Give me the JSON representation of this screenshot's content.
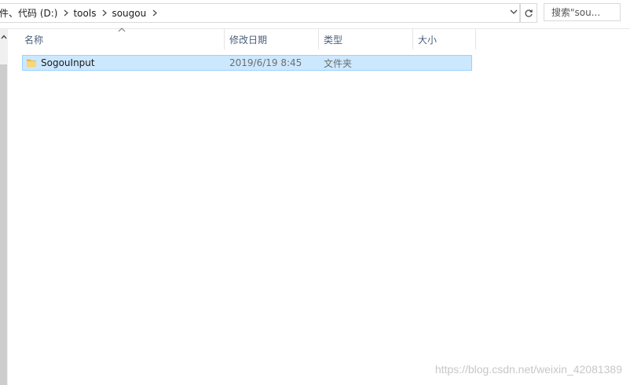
{
  "address_bar": {
    "crumbs": [
      "件、代码 (D:)",
      "tools",
      "sougou"
    ]
  },
  "search": {
    "placeholder": "搜索\"sou..."
  },
  "columns": {
    "name": "名称",
    "modified": "修改日期",
    "type": "类型",
    "size": "大小"
  },
  "files": [
    {
      "name": "SogouInput",
      "modified": "2019/6/19 8:45",
      "type": "文件夹",
      "size": ""
    }
  ],
  "watermark": "https://blog.csdn.net/weixin_42081389",
  "colors": {
    "selection_bg": "#cce8ff",
    "selection_border": "#99d1ff",
    "header_text": "#4c607a",
    "folder_yellow": "#f8d775"
  },
  "icons": {
    "breadcrumb_separator": "chevron-right-icon",
    "address_dropdown": "chevron-down-icon",
    "refresh": "refresh-icon",
    "sort": "sort-up-icon",
    "folder": "folder-icon"
  }
}
